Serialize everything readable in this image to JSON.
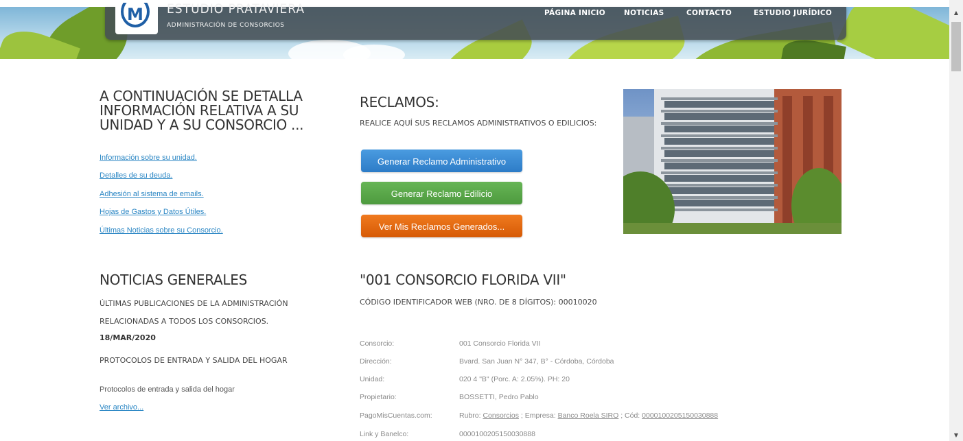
{
  "header": {
    "brand_title": "ESTUDIO PRATAVIERA",
    "brand_sub": "ADMINISTRACIÓN DE CONSORCIOS",
    "logo_letter": "M",
    "nav": [
      "PÁGINA INICIO",
      "NOTICIAS",
      "CONTACTO",
      "ESTUDIO JURÍDICO"
    ]
  },
  "info": {
    "title": "A CONTINUACIÓN SE DETALLA INFORMACIÓN RELATIVA A SU UNIDAD Y A SU CONSORCIO ...",
    "links": [
      "Información sobre su unidad.",
      "Detalles de su deuda.",
      "Adhesión al sistema de emails.",
      "Hojas de Gastos y Datos Útiles.",
      "Últimas Noticias sobre su Consorcio."
    ]
  },
  "reclamos": {
    "title": "RECLAMOS:",
    "subtitle": "REALICE AQUÍ SUS RECLAMOS ADMINISTRATIVOS O EDILICIOS:",
    "btn_admin": "Generar Reclamo Administrativo",
    "btn_edilicio": "Generar Reclamo Edilicio",
    "btn_ver": "Ver Mis Reclamos Generados..."
  },
  "noticias": {
    "title": "NOTICIAS GENERALES",
    "subtitle_1": "ÚLTIMAS PUBLICACIONES DE LA ADMINISTRACIÓN",
    "subtitle_2": "RELACIONADAS A TODOS LOS CONSORCIOS.",
    "date": "18/MAR/2020",
    "headline": "PROTOCOLOS DE ENTRADA Y SALIDA DEL HOGAR",
    "body": "Protocolos de entrada y salida del hogar",
    "link": "Ver archivo..."
  },
  "consorcio": {
    "title": "\"001 CONSORCIO FLORIDA VII\"",
    "code_line": "CÓDIGO IDENTIFICADOR WEB (NRO. DE 8 DÍGITOS): 00010020",
    "rows": [
      {
        "label": "Consorcio:",
        "value": "001 Consorcio Florida VII"
      },
      {
        "label": "Dirección:",
        "value": "Bvard. San Juan N° 347, B° - Córdoba, Córdoba"
      },
      {
        "label": "Unidad:",
        "value": "020 4 \"B\" (Porc. A: 2.05%). PH: 20"
      },
      {
        "label": "Propietario:",
        "value": "BOSSETTI, Pedro Pablo"
      },
      {
        "label": "PagoMisCuentas.com:",
        "value": ""
      },
      {
        "label": "Link y Banelco:",
        "value": "0000100205150030888"
      }
    ],
    "pmc": {
      "rubro_label": "Rubro: ",
      "rubro": "Consorcios",
      "empresa_label": " ; Empresa: ",
      "empresa": "Banco Roela SIRO",
      "cod_label": " ; Cód: ",
      "cod": "0000100205150030888"
    }
  },
  "colors": {
    "link": "#2a86c4",
    "btn_blue": "#337ab7",
    "btn_green": "#5cb85c",
    "btn_orange": "#e8650e",
    "navbar": "#464e54"
  }
}
